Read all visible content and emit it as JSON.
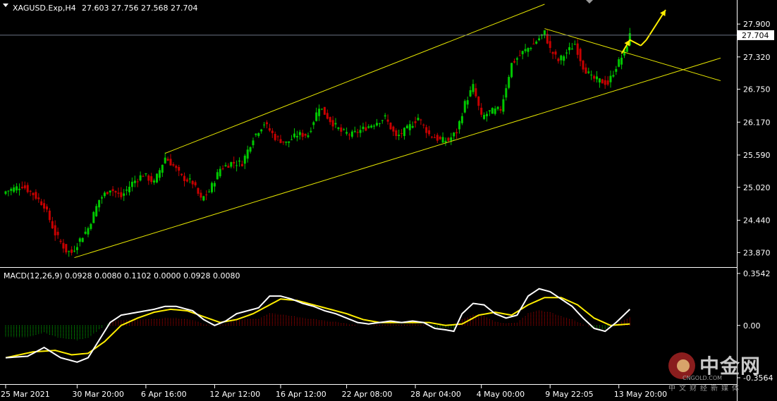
{
  "header": {
    "symbol_tf": "XAGUSD.Exp,H4",
    "ohlc": "27.603 27.756 27.568 27.704"
  },
  "macd_header": "MACD(12,26,9) 0.0928 0.0080 0.1102 0.0000 0.0928 0.0080",
  "current_price": "27.704",
  "watermark": {
    "title": "中金网",
    "url": "CNGOLD.COM",
    "subtitle": "中文财经新媒体"
  },
  "colors": {
    "bull": "#00c800",
    "bear": "#c80000",
    "channel": "#e6e600",
    "arrow": "#ffee00",
    "macd_line": "#ffffff",
    "signal_line": "#ffee00"
  },
  "chart_data": [
    {
      "type": "candlestick",
      "title": "XAGUSD.Exp,H4",
      "x_ticks": [
        "25 Mar 2021",
        "30 Mar 20:00",
        "6 Apr 16:00",
        "12 Apr 12:00",
        "16 Apr 12:00",
        "22 Apr 08:00",
        "28 Apr 04:00",
        "4 May 00:00",
        "9 May 22:05",
        "13 May 20:00"
      ],
      "y_ticks": [
        27.9,
        27.32,
        26.75,
        26.17,
        25.59,
        25.02,
        24.44,
        23.87
      ],
      "ylim": [
        23.7,
        28.2
      ],
      "current_price": 27.704,
      "close_path": [
        {
          "i": 0,
          "close": 24.95
        },
        {
          "i": 6,
          "close": 25.05
        },
        {
          "i": 10,
          "close": 24.9
        },
        {
          "i": 14,
          "close": 24.7
        },
        {
          "i": 18,
          "close": 24.2
        },
        {
          "i": 22,
          "close": 23.9
        },
        {
          "i": 24,
          "close": 23.87
        },
        {
          "i": 27,
          "close": 24.1
        },
        {
          "i": 30,
          "close": 24.3
        },
        {
          "i": 34,
          "close": 24.8
        },
        {
          "i": 38,
          "close": 25.0
        },
        {
          "i": 42,
          "close": 24.85
        },
        {
          "i": 46,
          "close": 25.1
        },
        {
          "i": 50,
          "close": 25.25
        },
        {
          "i": 54,
          "close": 25.1
        },
        {
          "i": 58,
          "close": 25.55
        },
        {
          "i": 61,
          "close": 25.4
        },
        {
          "i": 64,
          "close": 25.2
        },
        {
          "i": 68,
          "close": 25.1
        },
        {
          "i": 71,
          "close": 24.8
        },
        {
          "i": 74,
          "close": 24.95
        },
        {
          "i": 78,
          "close": 25.35
        },
        {
          "i": 82,
          "close": 25.45
        },
        {
          "i": 86,
          "close": 25.45
        },
        {
          "i": 90,
          "close": 25.9
        },
        {
          "i": 94,
          "close": 26.15
        },
        {
          "i": 98,
          "close": 25.9
        },
        {
          "i": 102,
          "close": 25.8
        },
        {
          "i": 106,
          "close": 25.95
        },
        {
          "i": 110,
          "close": 25.95
        },
        {
          "i": 114,
          "close": 26.45
        },
        {
          "i": 118,
          "close": 26.2
        },
        {
          "i": 122,
          "close": 26.0
        },
        {
          "i": 126,
          "close": 25.95
        },
        {
          "i": 130,
          "close": 26.05
        },
        {
          "i": 134,
          "close": 26.15
        },
        {
          "i": 138,
          "close": 26.25
        },
        {
          "i": 142,
          "close": 25.9
        },
        {
          "i": 146,
          "close": 26.05
        },
        {
          "i": 150,
          "close": 26.25
        },
        {
          "i": 154,
          "close": 25.95
        },
        {
          "i": 158,
          "close": 25.85
        },
        {
          "i": 161,
          "close": 25.85
        },
        {
          "i": 164,
          "close": 26.0
        },
        {
          "i": 167,
          "close": 26.5
        },
        {
          "i": 170,
          "close": 26.8
        },
        {
          "i": 173,
          "close": 26.25
        },
        {
          "i": 176,
          "close": 26.35
        },
        {
          "i": 180,
          "close": 26.4
        },
        {
          "i": 184,
          "close": 27.2
        },
        {
          "i": 188,
          "close": 27.4
        },
        {
          "i": 192,
          "close": 27.55
        },
        {
          "i": 196,
          "close": 27.75
        },
        {
          "i": 198,
          "close": 27.45
        },
        {
          "i": 201,
          "close": 27.25
        },
        {
          "i": 204,
          "close": 27.4
        },
        {
          "i": 207,
          "close": 27.55
        },
        {
          "i": 210,
          "close": 27.15
        },
        {
          "i": 213,
          "close": 26.95
        },
        {
          "i": 216,
          "close": 26.9
        },
        {
          "i": 219,
          "close": 26.85
        },
        {
          "i": 222,
          "close": 27.15
        },
        {
          "i": 225,
          "close": 27.4
        },
        {
          "i": 227,
          "close": 27.7
        }
      ],
      "channel_upper": [
        {
          "i": 58,
          "price": 25.62
        },
        {
          "i": 196,
          "price": 28.25
        }
      ],
      "channel_lower": [
        {
          "i": 25,
          "price": 23.78
        },
        {
          "i": 260,
          "price": 27.3
        }
      ],
      "resistance_line": [
        {
          "i": 196,
          "price": 27.82
        },
        {
          "i": 260,
          "price": 26.9
        }
      ],
      "arrow_path": [
        {
          "i": 224,
          "price": 27.38
        },
        {
          "i": 227,
          "price": 27.62
        },
        {
          "i": 231,
          "price": 27.52
        },
        {
          "i": 233,
          "price": 27.62
        },
        {
          "i": 240,
          "price": 28.15
        }
      ]
    },
    {
      "type": "line",
      "title": "MACD(12,26,9)",
      "y_ticks": [
        0.3542,
        0.0,
        -0.3564
      ],
      "ylim": [
        -0.3564,
        0.3542
      ],
      "series": [
        {
          "name": "MACD",
          "points": [
            [
              0,
              -0.22
            ],
            [
              8,
              -0.21
            ],
            [
              14,
              -0.15
            ],
            [
              20,
              -0.22
            ],
            [
              26,
              -0.25
            ],
            [
              30,
              -0.22
            ],
            [
              34,
              -0.1
            ],
            [
              38,
              0.02
            ],
            [
              42,
              0.07
            ],
            [
              48,
              0.09
            ],
            [
              54,
              0.11
            ],
            [
              58,
              0.13
            ],
            [
              62,
              0.13
            ],
            [
              68,
              0.1
            ],
            [
              72,
              0.04
            ],
            [
              76,
              0.0
            ],
            [
              80,
              0.03
            ],
            [
              84,
              0.08
            ],
            [
              88,
              0.1
            ],
            [
              92,
              0.12
            ],
            [
              96,
              0.2
            ],
            [
              100,
              0.2
            ],
            [
              104,
              0.18
            ],
            [
              108,
              0.15
            ],
            [
              112,
              0.13
            ],
            [
              116,
              0.1
            ],
            [
              120,
              0.08
            ],
            [
              124,
              0.05
            ],
            [
              128,
              0.02
            ],
            [
              132,
              0.01
            ],
            [
              136,
              0.02
            ],
            [
              140,
              0.03
            ],
            [
              144,
              0.02
            ],
            [
              148,
              0.03
            ],
            [
              152,
              0.02
            ],
            [
              156,
              -0.02
            ],
            [
              160,
              -0.03
            ],
            [
              163,
              -0.04
            ],
            [
              166,
              0.08
            ],
            [
              170,
              0.15
            ],
            [
              174,
              0.14
            ],
            [
              178,
              0.08
            ],
            [
              182,
              0.05
            ],
            [
              186,
              0.07
            ],
            [
              190,
              0.2
            ],
            [
              194,
              0.25
            ],
            [
              198,
              0.23
            ],
            [
              202,
              0.18
            ],
            [
              206,
              0.13
            ],
            [
              210,
              0.05
            ],
            [
              214,
              -0.02
            ],
            [
              218,
              -0.04
            ],
            [
              222,
              0.02
            ],
            [
              227,
              0.11
            ]
          ]
        },
        {
          "name": "Signal",
          "points": [
            [
              0,
              -0.22
            ],
            [
              10,
              -0.18
            ],
            [
              18,
              -0.17
            ],
            [
              24,
              -0.2
            ],
            [
              30,
              -0.19
            ],
            [
              36,
              -0.11
            ],
            [
              42,
              0.0
            ],
            [
              48,
              0.05
            ],
            [
              54,
              0.09
            ],
            [
              60,
              0.11
            ],
            [
              66,
              0.1
            ],
            [
              72,
              0.06
            ],
            [
              78,
              0.02
            ],
            [
              84,
              0.04
            ],
            [
              90,
              0.08
            ],
            [
              96,
              0.14
            ],
            [
              100,
              0.18
            ],
            [
              106,
              0.17
            ],
            [
              112,
              0.14
            ],
            [
              118,
              0.11
            ],
            [
              124,
              0.08
            ],
            [
              130,
              0.04
            ],
            [
              136,
              0.02
            ],
            [
              142,
              0.02
            ],
            [
              148,
              0.02
            ],
            [
              154,
              0.02
            ],
            [
              160,
              0.0
            ],
            [
              166,
              0.01
            ],
            [
              172,
              0.07
            ],
            [
              178,
              0.09
            ],
            [
              184,
              0.07
            ],
            [
              190,
              0.14
            ],
            [
              196,
              0.19
            ],
            [
              202,
              0.19
            ],
            [
              208,
              0.14
            ],
            [
              214,
              0.05
            ],
            [
              220,
              0.0
            ],
            [
              227,
              0.01
            ]
          ]
        }
      ]
    }
  ]
}
